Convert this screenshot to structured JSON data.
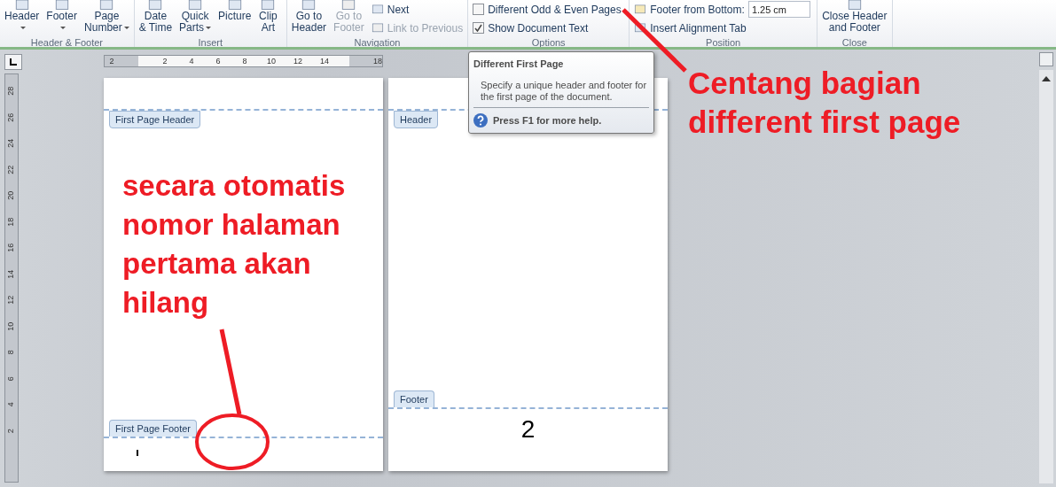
{
  "ribbon": {
    "groups": [
      {
        "label": "Header & Footer",
        "items": [
          {
            "kind": "large",
            "label": "Header",
            "dropdown": true,
            "disabled": false
          },
          {
            "kind": "large",
            "label": "Footer",
            "dropdown": true,
            "disabled": false
          },
          {
            "kind": "large",
            "label": "Page\nNumber",
            "dropdown": true,
            "disabled": false
          }
        ]
      },
      {
        "label": "Insert",
        "items": [
          {
            "kind": "large",
            "label": "Date\n& Time",
            "dropdown": false,
            "disabled": false
          },
          {
            "kind": "large",
            "label": "Quick\nParts",
            "dropdown": true,
            "disabled": false
          },
          {
            "kind": "large",
            "label": "Picture",
            "dropdown": false,
            "disabled": false
          },
          {
            "kind": "large",
            "label": "Clip\nArt",
            "dropdown": false,
            "disabled": false
          }
        ]
      },
      {
        "label": "Navigation",
        "items": [
          {
            "kind": "large",
            "label": "Go to\nHeader",
            "dropdown": false,
            "disabled": false
          },
          {
            "kind": "large",
            "label": "Go to\nFooter",
            "dropdown": false,
            "disabled": true
          },
          {
            "kind": "stack",
            "items": [
              {
                "kind": "small",
                "label": "Next",
                "disabled": false
              },
              {
                "kind": "small",
                "label": "Link to Previous",
                "disabled": true
              }
            ]
          }
        ]
      },
      {
        "label": "Options",
        "items": [
          {
            "kind": "stack",
            "items": [
              {
                "kind": "check",
                "label": "Different Odd & Even Pages",
                "checked": false
              },
              {
                "kind": "check",
                "label": "Show Document Text",
                "checked": true
              }
            ]
          }
        ]
      },
      {
        "label": "Position",
        "items": [
          {
            "kind": "stack",
            "items": [
              {
                "kind": "spin",
                "label": "Footer from Bottom:",
                "value": "1.25 cm"
              },
              {
                "kind": "small",
                "label": "Insert Alignment Tab",
                "disabled": false
              }
            ]
          }
        ]
      },
      {
        "label": "Close",
        "items": [
          {
            "kind": "large",
            "label": "Close Header\nand Footer",
            "dropdown": false,
            "disabled": false
          }
        ]
      }
    ]
  },
  "ruler": {
    "horizontal": [
      "2",
      "2",
      "4",
      "6",
      "8",
      "10",
      "12",
      "14",
      "18"
    ],
    "vertical": [
      "28",
      "26",
      "24",
      "22",
      "20",
      "18",
      "16",
      "14",
      "12",
      "10",
      "8",
      "6",
      "4",
      "2"
    ]
  },
  "pages": [
    {
      "header_tab": "First Page Header",
      "footer_tab": "First Page Footer",
      "cursor": true
    },
    {
      "header_tab": "Header",
      "footer_tab": "Footer",
      "page_number": "2",
      "cursor": false
    }
  ],
  "tooltip": {
    "title": "Different First Page",
    "body": "Specify a unique header and footer for the first page of the document.",
    "help": "Press F1 for more help."
  },
  "annotations": [
    {
      "text": "Centang bagian different first page"
    },
    {
      "text": "secara otomatis nomor halaman pertama akan hilang"
    }
  ]
}
